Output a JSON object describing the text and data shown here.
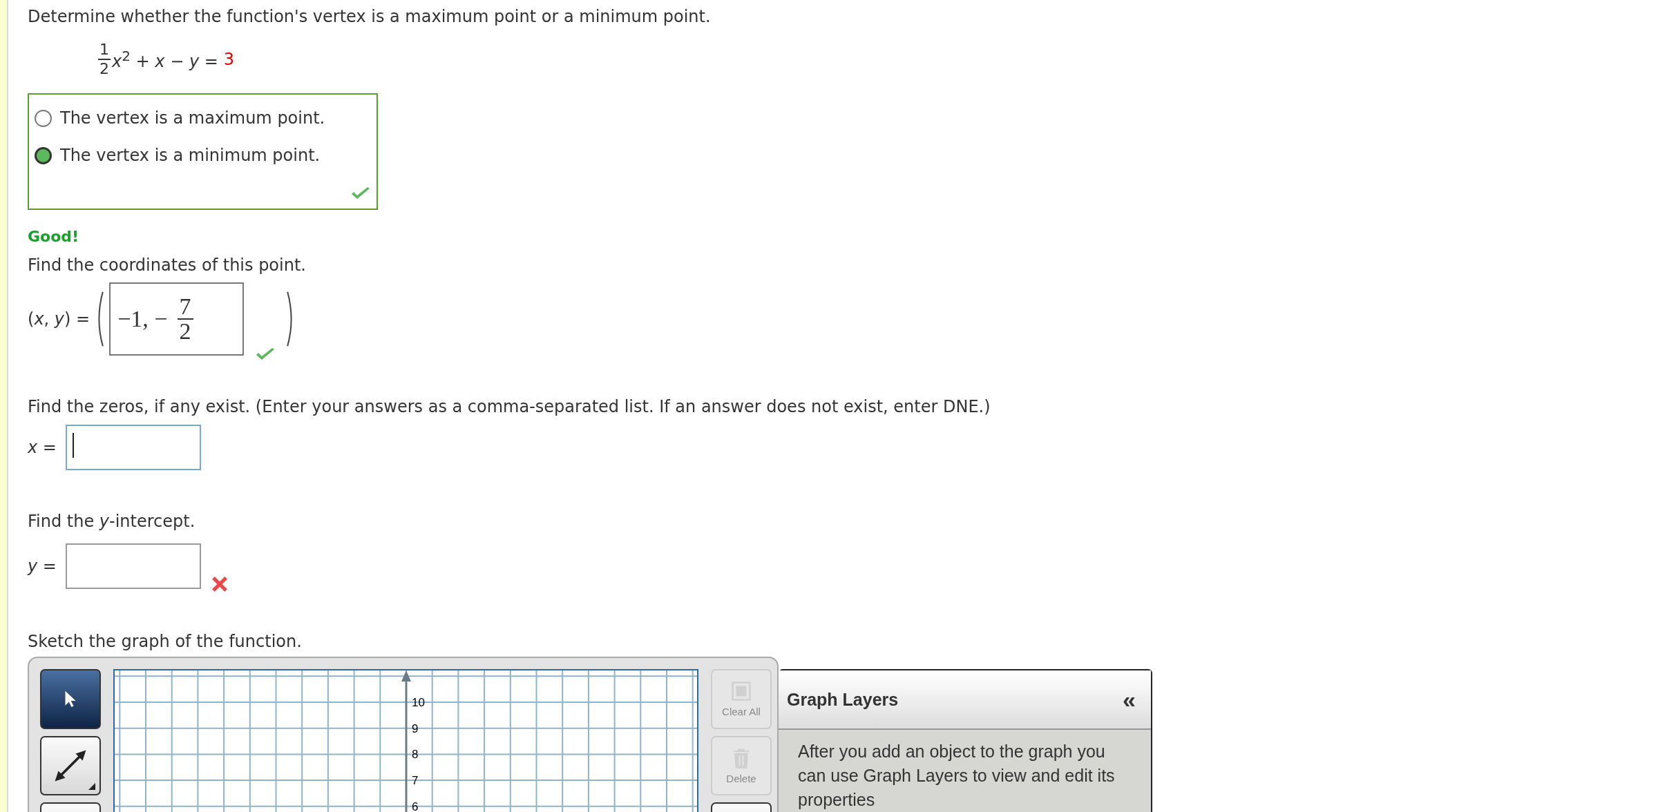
{
  "vertex_question": {
    "prompt": "Determine whether the function's vertex is a maximum point or a minimum point.",
    "equation": {
      "numerator": "1",
      "denominator": "2",
      "expression": "*x*$^{2}$ + *x* − *y* =",
      "constant": "3"
    },
    "choices": [
      {
        "label": "The vertex is a maximum point.",
        "selected": false
      },
      {
        "label": "The vertex is a minimum point.",
        "selected": true
      }
    ],
    "correct": true
  },
  "feedback": "Good!",
  "coordinates": {
    "prompt": "Find the coordinates of this point.",
    "label": "(*x*, *y*) =",
    "value_lead": "−1, −",
    "value_numerator": "7",
    "value_denominator": "2",
    "correct": true
  },
  "zeros": {
    "prompt": "Find the zeros, if any exist. (Enter your answers as a comma-separated list. If an answer does not exist, enter DNE.)",
    "label": "*x* =",
    "focused": true
  },
  "intercept": {
    "prompt": "Find the *y*-intercept.",
    "label": "*y* =",
    "focused": false,
    "correct": false
  },
  "graph": {
    "prompt": "Sketch the graph of the function.",
    "tools": [
      {
        "kind": "pointer",
        "selected": true
      },
      {
        "kind": "line",
        "selected": false
      },
      {
        "kind": "unknown",
        "selected": false
      }
    ],
    "actions": [
      {
        "kind": "clear",
        "label": "Clear All",
        "disabled": true
      },
      {
        "kind": "delete",
        "label": "Delete",
        "disabled": true
      },
      {
        "kind": "unknown",
        "disabled": false
      }
    ],
    "y_ticks": [
      "10",
      "9",
      "8",
      "7",
      "6"
    ],
    "layers": {
      "title": "Graph Layers",
      "collapse": "«",
      "text": "After you add an object to the graph you can use Graph Layers to view and edit its properties"
    }
  }
}
